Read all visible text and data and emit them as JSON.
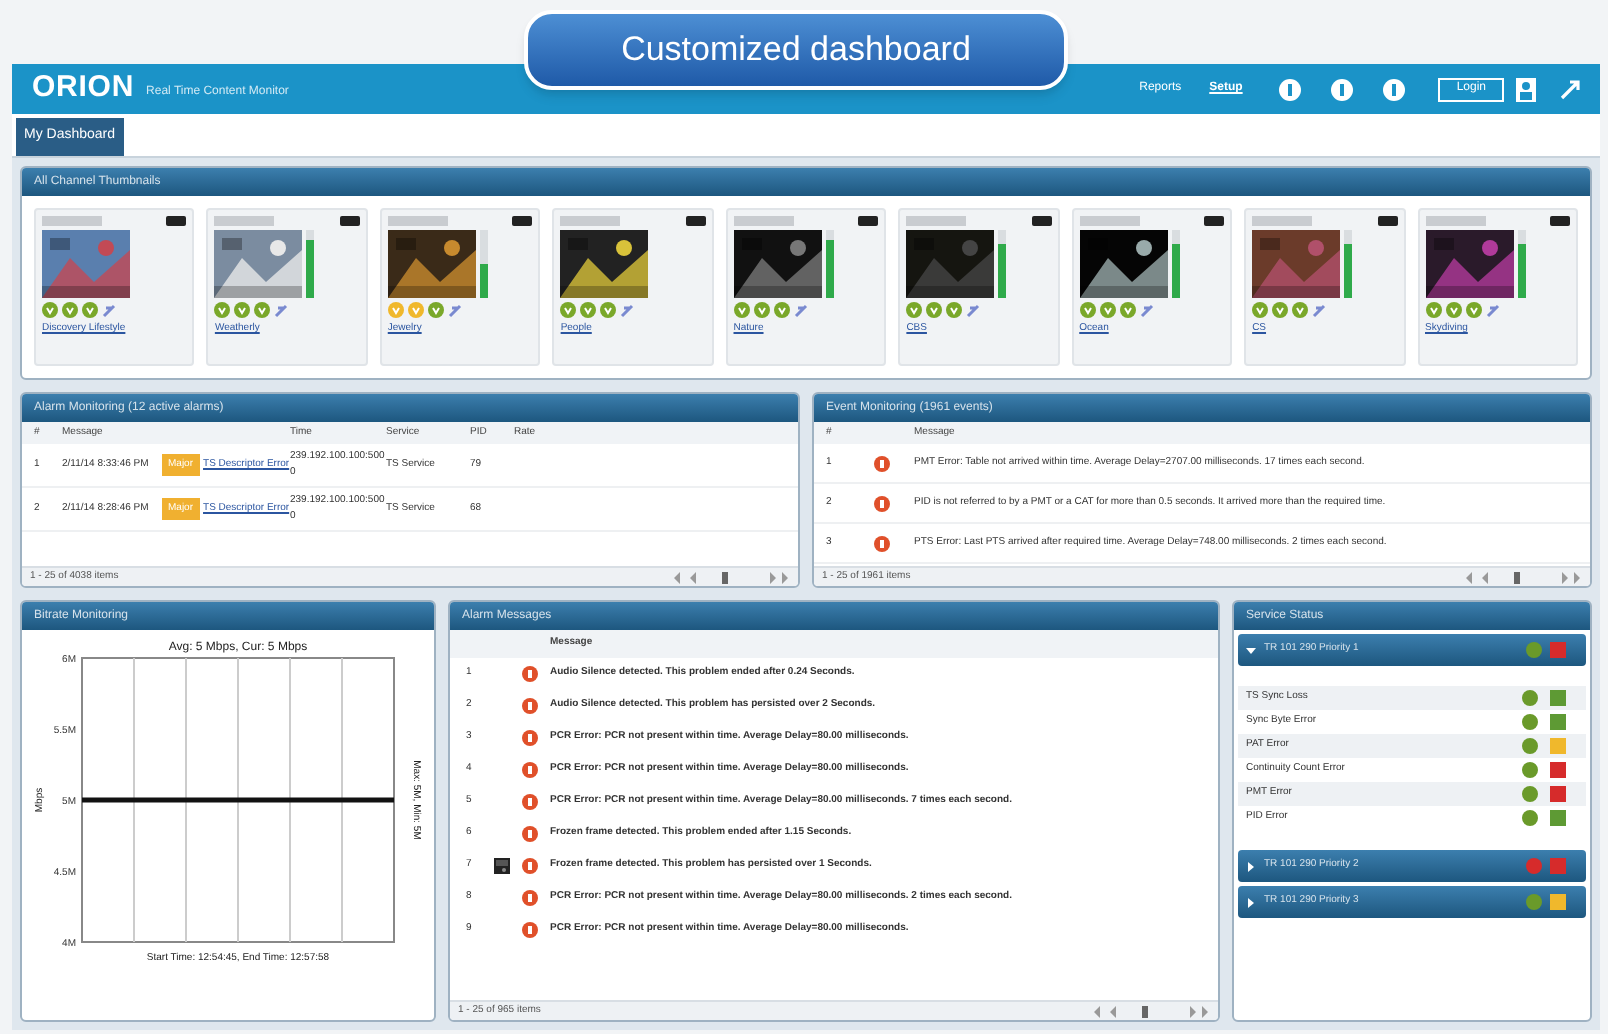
{
  "banner": {
    "title": "Customized dashboard"
  },
  "header": {
    "logo": "ORION",
    "tagline": "Real Time Content Monitor",
    "nav": [
      {
        "label": "Reports",
        "selected": false
      },
      {
        "label": "Setup",
        "selected": true
      }
    ],
    "login": "Login"
  },
  "tabs": [
    {
      "label": "My Dashboard",
      "selected": true
    }
  ],
  "thumbnails_panel": {
    "title": "All Channel Thumbnails",
    "channels": [
      {
        "name": "Discovery Lifestyle",
        "status": [
          {
            "color": "#7aa82a"
          },
          {
            "color": "#7aa82a"
          },
          {
            "color": "#7aa82a"
          }
        ]
      },
      {
        "name": "Weatherly",
        "status": [
          {
            "color": "#7aa82a"
          },
          {
            "color": "#7aa82a"
          },
          {
            "color": "#7aa82a"
          }
        ],
        "level": 0.85
      },
      {
        "name": "Jewelry",
        "status": [
          {
            "color": "#f0b82c"
          },
          {
            "color": "#f0b82c"
          },
          {
            "color": "#7aa82a"
          }
        ],
        "level": 0.5
      },
      {
        "name": "People",
        "status": [
          {
            "color": "#7aa82a"
          },
          {
            "color": "#7aa82a"
          },
          {
            "color": "#7aa82a"
          }
        ]
      },
      {
        "name": "Nature",
        "status": [
          {
            "color": "#7aa82a"
          },
          {
            "color": "#7aa82a"
          },
          {
            "color": "#7aa82a"
          }
        ],
        "level": 0.85
      },
      {
        "name": "CBS",
        "status": [
          {
            "color": "#7aa82a"
          },
          {
            "color": "#7aa82a"
          },
          {
            "color": "#7aa82a"
          }
        ],
        "level": 0.8
      },
      {
        "name": "Ocean",
        "status": [
          {
            "color": "#7aa82a"
          },
          {
            "color": "#7aa82a"
          },
          {
            "color": "#7aa82a"
          }
        ],
        "level": 0.8
      },
      {
        "name": "CS",
        "status": [
          {
            "color": "#7aa82a"
          },
          {
            "color": "#7aa82a"
          },
          {
            "color": "#7aa82a"
          }
        ],
        "level": 0.8
      },
      {
        "name": "Skydiving",
        "status": [
          {
            "color": "#7aa82a"
          },
          {
            "color": "#7aa82a"
          },
          {
            "color": "#7aa82a"
          }
        ],
        "level": 0.8
      }
    ]
  },
  "alarm_panel": {
    "title": "Alarm Monitoring (12 active alarms)",
    "columns": [
      "#",
      "Message",
      "Time",
      "Service",
      "PID",
      "Rate"
    ],
    "rows": [
      {
        "num": "1",
        "time": "2/11/14 8:33:46 PM",
        "severity": "Major",
        "link": "TS Descriptor Error",
        "source": "239.192.100.100:5000",
        "service": "TS Service",
        "pid": "79"
      },
      {
        "num": "2",
        "time": "2/11/14 8:28:46 PM",
        "severity": "Major",
        "link": "TS Descriptor Error",
        "source": "239.192.100.100:5000",
        "service": "TS Service",
        "pid": "68"
      }
    ],
    "footer": "1 - 25 of 4038 items"
  },
  "events_panel": {
    "title": "Event Monitoring (1961 events)",
    "columns": [
      "#",
      "Message"
    ],
    "rows": [
      {
        "num": "1",
        "message": "PMT Error: Table not arrived within time. Average Delay=2707.00 milliseconds. 17 times each second."
      },
      {
        "num": "2",
        "message": "PID is not referred to by a PMT or a CAT for more than 0.5 seconds. It arrived more than the required time."
      },
      {
        "num": "3",
        "message": "PTS Error: Last PTS arrived after required time. Average Delay=748.00 milliseconds. 2 times each second."
      }
    ],
    "footer": "1 - 25 of 1961 items"
  },
  "bitrate_panel": {
    "title": "Bitrate Monitoring",
    "chart": {
      "title": "Avg: 5 Mbps, Cur: 5 Mbps",
      "xlabel": "Start Time: 12:54:45, End Time: 12:57:58",
      "ylabel": "Mbps",
      "ytick_labels": [
        "6M",
        "5.5M",
        "5M",
        "4.5M",
        "4M"
      ]
    },
    "side_label": "Max: 5M, Min: 5M"
  },
  "messages_panel": {
    "title": "Alarm Messages",
    "column": "Message",
    "rows": [
      {
        "num": "1",
        "message": "Audio Silence detected. This problem ended after 0.24 Seconds."
      },
      {
        "num": "2",
        "message": "Audio Silence detected. This problem has persisted over 2 Seconds."
      },
      {
        "num": "3",
        "message": "PCR Error: PCR not present within time. Average Delay=80.00 milliseconds."
      },
      {
        "num": "4",
        "message": "PCR Error: PCR not present within time. Average Delay=80.00 milliseconds."
      },
      {
        "num": "5",
        "message": "PCR Error: PCR not present within time. Average Delay=80.00 milliseconds. 7 times each second."
      },
      {
        "num": "6",
        "message": "Frozen frame detected. This problem ended after 1.15 Seconds."
      },
      {
        "num": "7",
        "message": "Frozen frame detected. This problem has persisted over 1 Seconds."
      },
      {
        "num": "8",
        "message": "PCR Error: PCR not present within time. Average Delay=80.00 milliseconds. 2 times each second."
      },
      {
        "num": "9",
        "message": "PCR Error: PCR not present within time. Average Delay=80.00 milliseconds."
      }
    ],
    "footer": "1 - 25 of 965 items"
  },
  "status_panel": {
    "title": "Service Status",
    "groups": [
      {
        "title": "TR 101 290 Priority 1",
        "expanded": true,
        "dot": {
          "color": "#6a9a2a"
        },
        "square": {
          "color": "#d62b2b"
        },
        "items": [
          {
            "label": "TS Sync Loss",
            "dot": {
              "color": "#6a9a2a"
            },
            "square": {
              "color": "#5e9a34"
            }
          },
          {
            "label": "Sync Byte Error",
            "dot": {
              "color": "#6a9a2a"
            },
            "square": {
              "color": "#5e9a34"
            }
          },
          {
            "label": "PAT Error",
            "dot": {
              "color": "#6a9a2a"
            },
            "square": {
              "color": "#f0b82c"
            }
          },
          {
            "label": "Continuity Count Error",
            "dot": {
              "color": "#6a9a2a"
            },
            "square": {
              "color": "#d62b2b"
            }
          },
          {
            "label": "PMT Error",
            "dot": {
              "color": "#6a9a2a"
            },
            "square": {
              "color": "#d62b2b"
            }
          },
          {
            "label": "PID Error",
            "dot": {
              "color": "#6a9a2a"
            },
            "square": {
              "color": "#5e9a34"
            }
          }
        ]
      },
      {
        "title": "TR 101 290 Priority 2",
        "expanded": false,
        "dot": {
          "color": "#d62b2b"
        },
        "square": {
          "color": "#d62b2b"
        }
      },
      {
        "title": "TR 101 290 Priority 3",
        "expanded": false,
        "dot": {
          "color": "#6a9a2a"
        },
        "square": {
          "color": "#f0b82c"
        }
      }
    ]
  }
}
